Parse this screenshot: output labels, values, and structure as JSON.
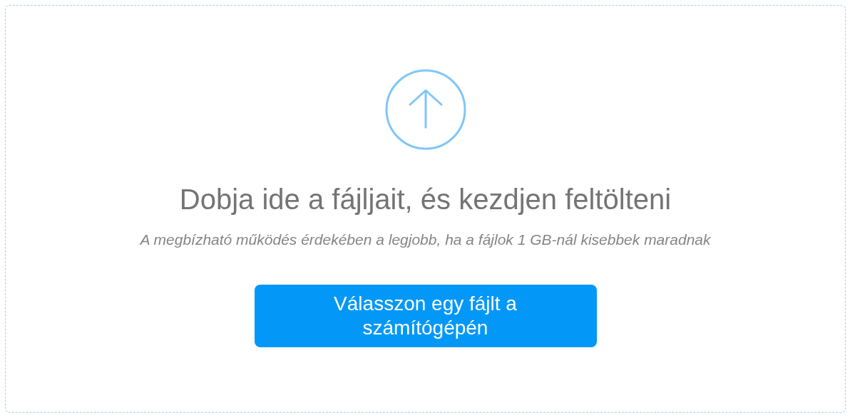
{
  "dropzone": {
    "title": "Dobja ide a fájljait, és kezdjen feltölteni",
    "hint": "A megbízható működés érdekében a legjobb, ha a fájlok 1 GB-nál kisebbek maradnak",
    "button": "Válasszon egy fájlt a számítógépén"
  }
}
